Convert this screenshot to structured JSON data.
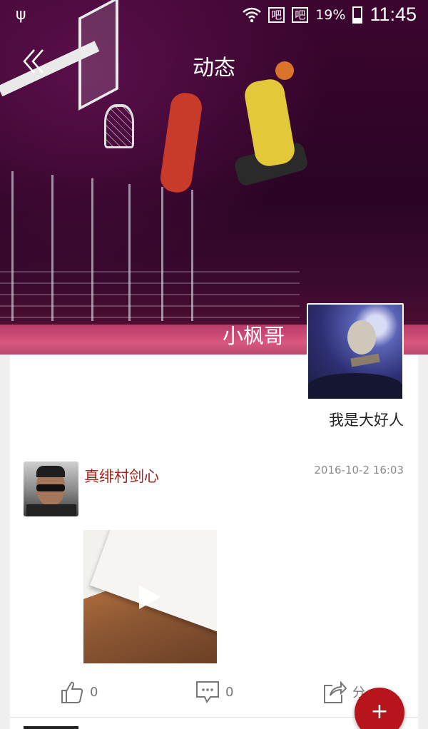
{
  "status_bar": {
    "battery_percent": "19%",
    "time": "11:45",
    "sim1": "吧",
    "sim2": "吧"
  },
  "header": {
    "title": "动态",
    "back_icon": "double-chevron-left-icon"
  },
  "profile": {
    "name": "小枫哥",
    "signature": "我是大好人"
  },
  "post": {
    "author": "真绯村剑心",
    "time": "2016-10-2 16:03",
    "like_count": "0",
    "comment_count": "0",
    "share_label": "分"
  },
  "colors": {
    "accent": "#b8141c",
    "author_name": "#a3241a",
    "header_bg": "#3c0530"
  },
  "fab": {
    "label": "+"
  }
}
